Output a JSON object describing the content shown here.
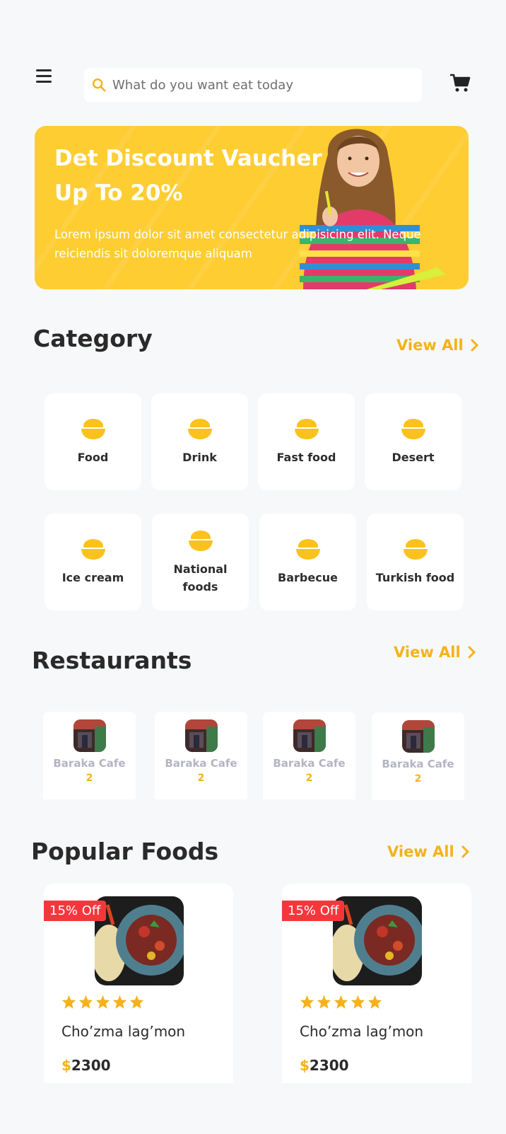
{
  "header": {
    "search_placeholder": "What do you want eat today"
  },
  "banner": {
    "title": "Det Discount Vaucher Up To 20%",
    "text": "Lorem ipsum dolor sit amet consectetur adipisicing elit. Neque reiciendis sit doloremque aliquam"
  },
  "category": {
    "title": "Category",
    "view_all": "View All",
    "items": [
      {
        "label": "Food"
      },
      {
        "label": "Drink"
      },
      {
        "label": "Fast food"
      },
      {
        "label": "Desert"
      },
      {
        "label": "Ice cream"
      },
      {
        "label": "National foods"
      },
      {
        "label": "Barbecue"
      },
      {
        "label": "Turkish food"
      }
    ]
  },
  "restaurants": {
    "title": "Restaurants",
    "view_all": "View All",
    "items": [
      {
        "name": "Baraka Cafe",
        "number": "2"
      },
      {
        "name": "Baraka Cafe",
        "number": "2"
      },
      {
        "name": "Baraka Cafe",
        "number": "2"
      },
      {
        "name": "Baraka Cafe",
        "number": "2"
      }
    ]
  },
  "popular": {
    "title": "Popular Foods",
    "view_all": "View All",
    "items": [
      {
        "badge": "15% Off",
        "rating": 5,
        "name": "Cho’zma lag’mon",
        "currency": "$",
        "price": "2300"
      },
      {
        "badge": "15% Off",
        "rating": 5,
        "name": "Cho’zma lag’mon",
        "currency": "$",
        "price": "2300"
      }
    ]
  },
  "colors": {
    "accent": "#f5b21c",
    "banner": "#fecd32",
    "badge": "#f5373b",
    "background": "#f7f8fa"
  }
}
